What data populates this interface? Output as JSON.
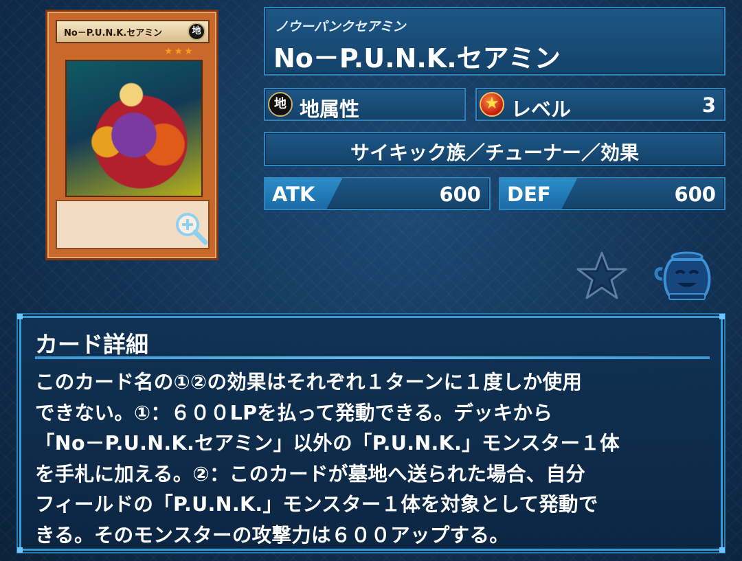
{
  "card_image": {
    "name": "No－P.U.N.K.セアミン",
    "attribute_glyph": "地",
    "stars": "★★★"
  },
  "card": {
    "reading": "ノウーパンクセアミン",
    "name": "No－P.U.N.K.セアミン",
    "attribute": {
      "icon_text": "地",
      "label": "地属性"
    },
    "level": {
      "label": "レベル",
      "value": "3"
    },
    "type_line": "サイキック族／チューナー／効果",
    "atk": {
      "label": "ATK",
      "value": "600"
    },
    "def": {
      "label": "DEF",
      "value": "600"
    }
  },
  "actions": {
    "favorite_icon": "star-icon",
    "pot_icon": "pot-icon",
    "zoom_icon": "magnifier-plus-icon"
  },
  "detail": {
    "header": "カード詳細",
    "text": "このカード名の①②の効果はそれぞれ１ターンに１度しか使用\nできない。①：６００LPを払って発動できる。デッキから\n「No－P.U.N.K.セアミン」以外の「P.U.N.K.」モンスター１体\nを手札に加える。②：このカードが墓地へ送られた場合、自分\nフィールドの「P.U.N.K.」モンスター１体を対象として発動で\nきる。そのモンスターの攻撃力は６００アップする。"
  },
  "colors": {
    "panel_fill": "#1d5785",
    "panel_border": "#2f86bf",
    "stat_tab": "#2c8ec8",
    "card_frame": "#c8682a",
    "star_icon": "#0f2c4e"
  }
}
